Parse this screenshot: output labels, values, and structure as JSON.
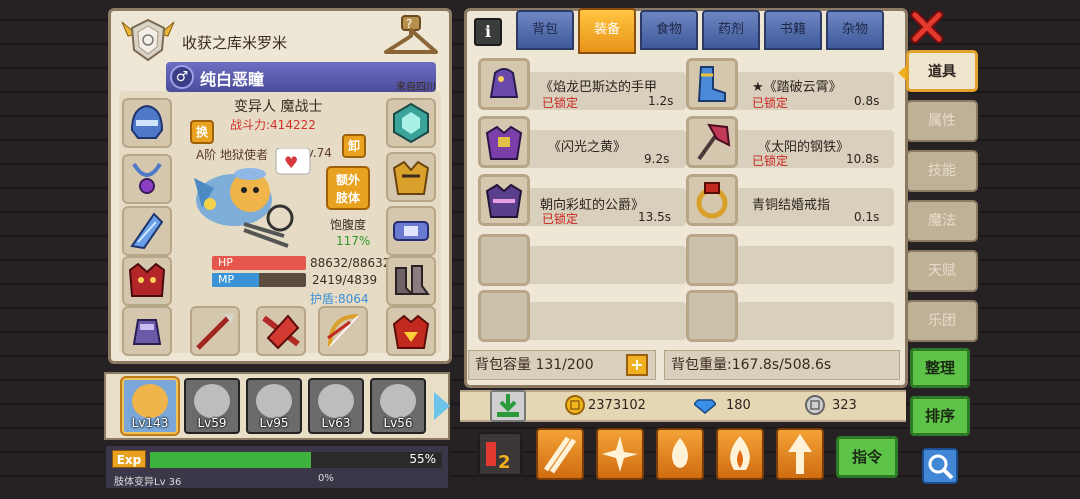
{
  "character": {
    "top_name": "收获之库米罗米",
    "gender_symbol": "♂",
    "name": "纯白恶瞳",
    "origin": "来自四川",
    "class": "变异人 魔战士",
    "power_label": "战斗力:414222",
    "title": "A阶 地狱使者",
    "level_tag": "Lv.74",
    "swap_label": "换",
    "unequip_label": "卸",
    "limb_label_1": "额外",
    "limb_label_2": "肢体",
    "satiety_label": "饱腹度",
    "satiety_value": "117%",
    "hp_label": "HP",
    "hp_value": "88632/88632",
    "hp_ratio": 1.0,
    "mp_label": "MP",
    "mp_value": "2419/4839",
    "mp_ratio": 0.5,
    "shield": "护盾:8064"
  },
  "party": [
    {
      "level": "Lv143",
      "active": true
    },
    {
      "level": "Lv59",
      "active": false
    },
    {
      "level": "Lv95",
      "active": false
    },
    {
      "level": "Lv63",
      "active": false
    },
    {
      "level": "Lv56",
      "active": false
    }
  ],
  "exp": {
    "tag": "Exp",
    "percent": "55%",
    "ratio": 0.55,
    "sub_label": "肢体变异Lv 36",
    "sub_percent": "0%"
  },
  "inventory": {
    "info_label": "i",
    "tabs": [
      "背包",
      "装备",
      "食物",
      "药剂",
      "书籍",
      "杂物"
    ],
    "active_tab": "装备",
    "items": [
      {
        "name": "《焰龙巴斯达的手甲",
        "lock": "已锁定",
        "weight": "1.2s"
      },
      {
        "name": "★《踏破云霄》",
        "lock": "已锁定",
        "weight": "0.8s"
      },
      {
        "name": "《闪光之黄》",
        "lock": "",
        "weight": "9.2s"
      },
      {
        "name": "《太阳的钢铁》",
        "lock": "已锁定",
        "weight": "10.8s"
      },
      {
        "name": "朝向彩虹的公爵》",
        "lock": "已锁定",
        "weight": "13.5s"
      },
      {
        "name": "青铜结婚戒指",
        "lock": "",
        "weight": "0.1s"
      }
    ],
    "capacity": "背包容量 131/200",
    "capacity_plus": "+",
    "weight": "背包重量:167.8s/508.6s"
  },
  "side_tabs": [
    "道具",
    "属性",
    "技能",
    "魔法",
    "天赋",
    "乐团"
  ],
  "side_active": "道具",
  "buttons": {
    "organize": "整理",
    "sort": "排序",
    "command": "指令"
  },
  "currency": {
    "gold": "2373102",
    "diamond": "180",
    "silver": "323"
  },
  "colors": {
    "accent_orange": "#e9a21f",
    "tab_blue": "#4f68a8",
    "locked_red": "#c9241d",
    "green_button": "#5ec449"
  }
}
